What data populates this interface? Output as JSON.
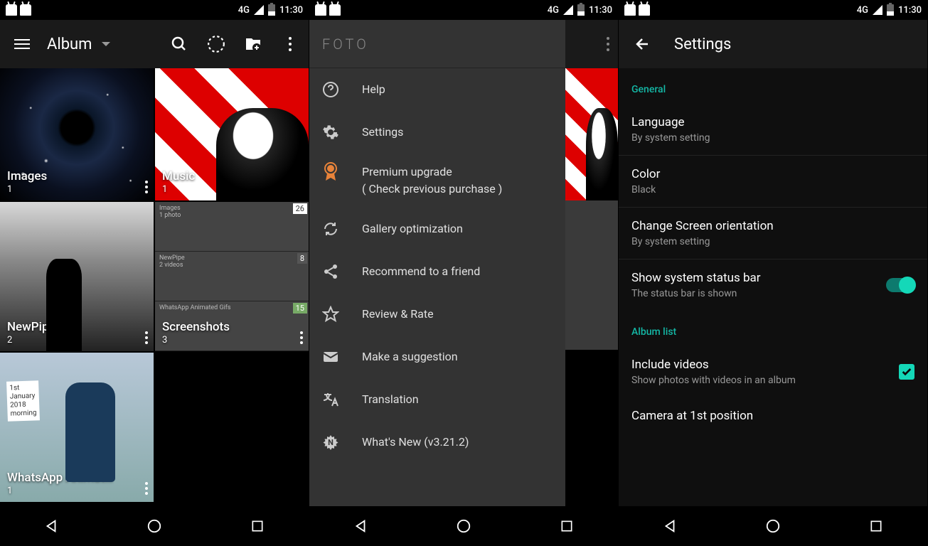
{
  "status_bar": {
    "network": "4G",
    "time": "11:30"
  },
  "screen1": {
    "title": "Album",
    "albums": [
      {
        "name": "Images",
        "count": "1"
      },
      {
        "name": "Music",
        "count": "1"
      },
      {
        "name": "NewPipe",
        "count": "2"
      },
      {
        "name": "Screenshots",
        "count": "3"
      },
      {
        "name": "WhatsApp Animat…",
        "count": "1"
      }
    ],
    "screenshot_minis": {
      "a": "Images",
      "a_sub": "1 photo",
      "a_num": "26",
      "b": "NewPipe",
      "b_sub": "2 videos",
      "b_num": "8",
      "c": "WhatsApp Animated Gifs",
      "c_num": "15"
    },
    "whatsapp_note": "1st\nJanuary\n2018\nmorning"
  },
  "screen2": {
    "drawer_logo": "FOTO",
    "items": {
      "help": "Help",
      "settings": "Settings",
      "premium": "Premium upgrade",
      "premium_sub": "( Check previous purchase )",
      "gallery_opt": "Gallery optimization",
      "recommend": "Recommend to a friend",
      "review": "Review & Rate",
      "suggestion": "Make a suggestion",
      "translation": "Translation",
      "whatsnew": "What's New (v3.21.2)"
    }
  },
  "screen3": {
    "title": "Settings",
    "sections": {
      "general": "General",
      "album_list": "Album list"
    },
    "language": {
      "title": "Language",
      "sub": "By system setting"
    },
    "color": {
      "title": "Color",
      "sub": "Black"
    },
    "orientation": {
      "title": "Change Screen orientation",
      "sub": "By system setting"
    },
    "status_bar": {
      "title": "Show system status bar",
      "sub": "The status bar is shown"
    },
    "include_videos": {
      "title": "Include videos",
      "sub": "Show photos with videos in an album"
    },
    "camera_pos": {
      "title": "Camera at 1st position"
    }
  }
}
